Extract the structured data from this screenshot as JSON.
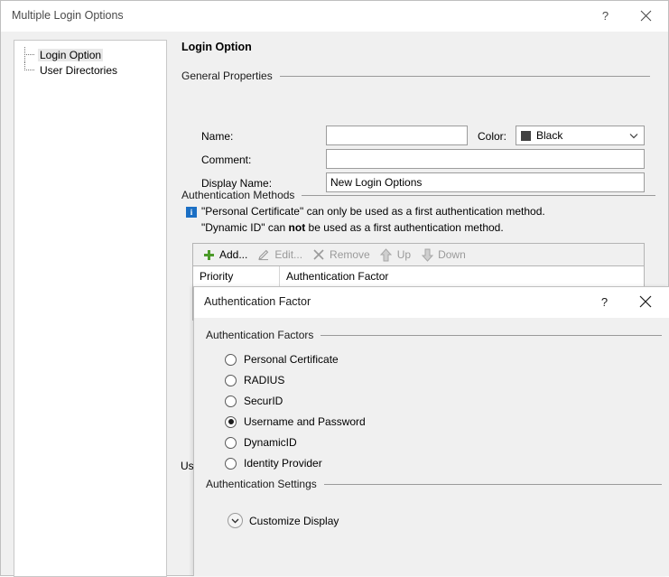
{
  "window": {
    "title": "Multiple Login Options",
    "help_label": "?",
    "close_label": "✕"
  },
  "tree": {
    "items": [
      {
        "label": "Login Option",
        "selected": true
      },
      {
        "label": "User Directories",
        "selected": false
      }
    ]
  },
  "page": {
    "title": "Login Option"
  },
  "general_properties": {
    "group_label": "General Properties",
    "name_label": "Name:",
    "name_value": "",
    "comment_label": "Comment:",
    "comment_value": "",
    "display_name_label": "Display Name:",
    "display_name_value": "New Login Options",
    "color_label": "Color:",
    "color_value": "Black",
    "color_swatch_hex": "#404040"
  },
  "authentication_methods": {
    "group_label": "Authentication Methods",
    "info_icon": "info-icon",
    "info_line_1": "\"Personal Certificate\" can only be used as a first authentication method.",
    "info_line_2_pre": "\"Dynamic ID\" can ",
    "info_line_2_bold": "not",
    "info_line_2_post": " be used as a first authentication method.",
    "toolbar": [
      {
        "label": "Add...",
        "icon": "plus-icon",
        "enabled": true
      },
      {
        "label": "Edit...",
        "icon": "pencil-icon",
        "enabled": false
      },
      {
        "label": "Remove",
        "icon": "cross-icon",
        "enabled": false
      },
      {
        "label": "Up",
        "icon": "arrow-up-icon",
        "enabled": false
      },
      {
        "label": "Down",
        "icon": "arrow-down-icon",
        "enabled": false
      }
    ],
    "columns": [
      "Priority",
      "Authentication Factor"
    ],
    "rows": []
  },
  "obscured": {
    "user_directories_cut": "Us"
  },
  "dialog": {
    "title": "Authentication Factor",
    "help_label": "?",
    "close_label": "✕",
    "factors_group_label": "Authentication Factors",
    "factors": [
      {
        "label": "Personal Certificate",
        "selected": false
      },
      {
        "label": "RADIUS",
        "selected": false
      },
      {
        "label": "SecurID",
        "selected": false
      },
      {
        "label": "Username and Password",
        "selected": true
      },
      {
        "label": "DynamicID",
        "selected": false
      },
      {
        "label": "Identity Provider",
        "selected": false
      }
    ],
    "settings_group_label": "Authentication Settings",
    "customize_display_label": "Customize Display",
    "customize_display_icon": "chevron-down-icon"
  }
}
